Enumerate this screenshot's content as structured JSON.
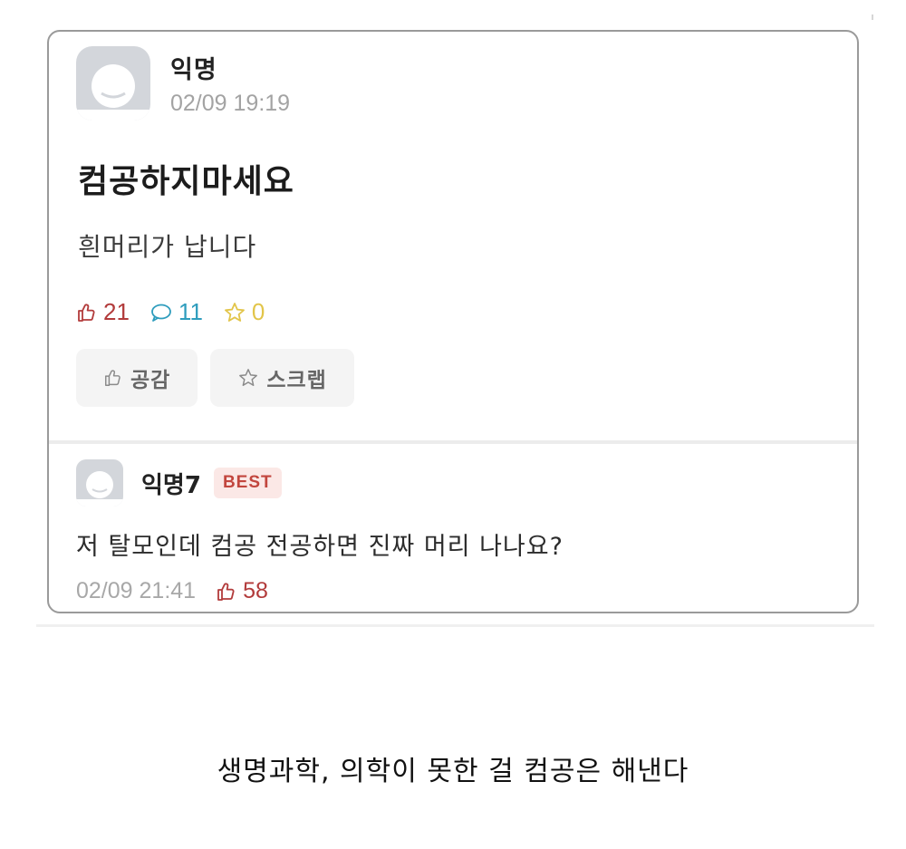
{
  "post": {
    "author": "익명",
    "time": "02/09 19:19",
    "title": "컴공하지마세요",
    "body": "흰머리가 납니다",
    "stats": {
      "likes": "21",
      "comments": "11",
      "scraps": "0"
    },
    "actions": {
      "like_label": "공감",
      "scrap_label": "스크랩"
    }
  },
  "comment": {
    "author": "익명7",
    "badge": "BEST",
    "body": "저 탈모인데 컴공 전공하면 진짜 머리 나나요?",
    "time": "02/09 21:41",
    "likes": "58"
  },
  "caption": "생명과학, 의학이 못한 걸 컴공은 해낸다",
  "colors": {
    "like_red": "#b23b3b",
    "comment_blue": "#2f9dbd",
    "scrap_yellow": "#e2c54a",
    "best_badge_bg": "#fbe8e6",
    "best_badge_text": "#c2463e"
  },
  "icons": {
    "avatar": "default-profile-icon",
    "like": "thumbs-up-icon",
    "comment": "speech-bubble-icon",
    "scrap": "star-icon"
  }
}
